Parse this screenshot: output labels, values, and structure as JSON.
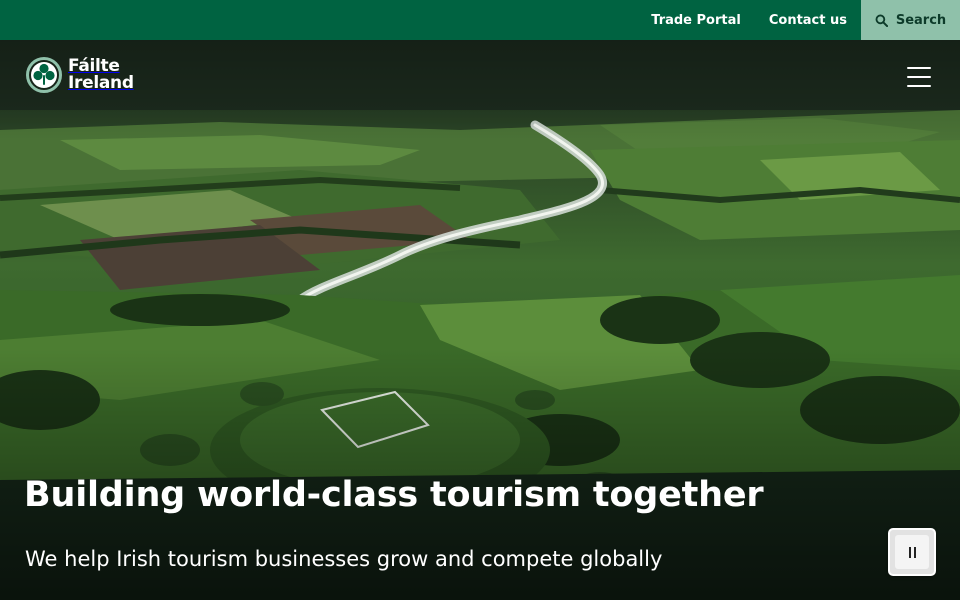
{
  "topbar": {
    "trade_portal": "Trade Portal",
    "contact_us": "Contact us",
    "search": "Search"
  },
  "logo": {
    "line1": "Fáilte",
    "line2": "Ireland"
  },
  "hero": {
    "headline": "Building world-class tourism together",
    "subline": "We help Irish tourism businesses grow and compete globally"
  },
  "icons": {
    "search": "search-icon",
    "menu": "hamburger-menu-icon",
    "pause": "pause-icon",
    "logo": "shamrock-logo-icon"
  },
  "colors": {
    "topbar": "#006341",
    "search_button": "#8fc1aa",
    "text": "#ffffff"
  }
}
